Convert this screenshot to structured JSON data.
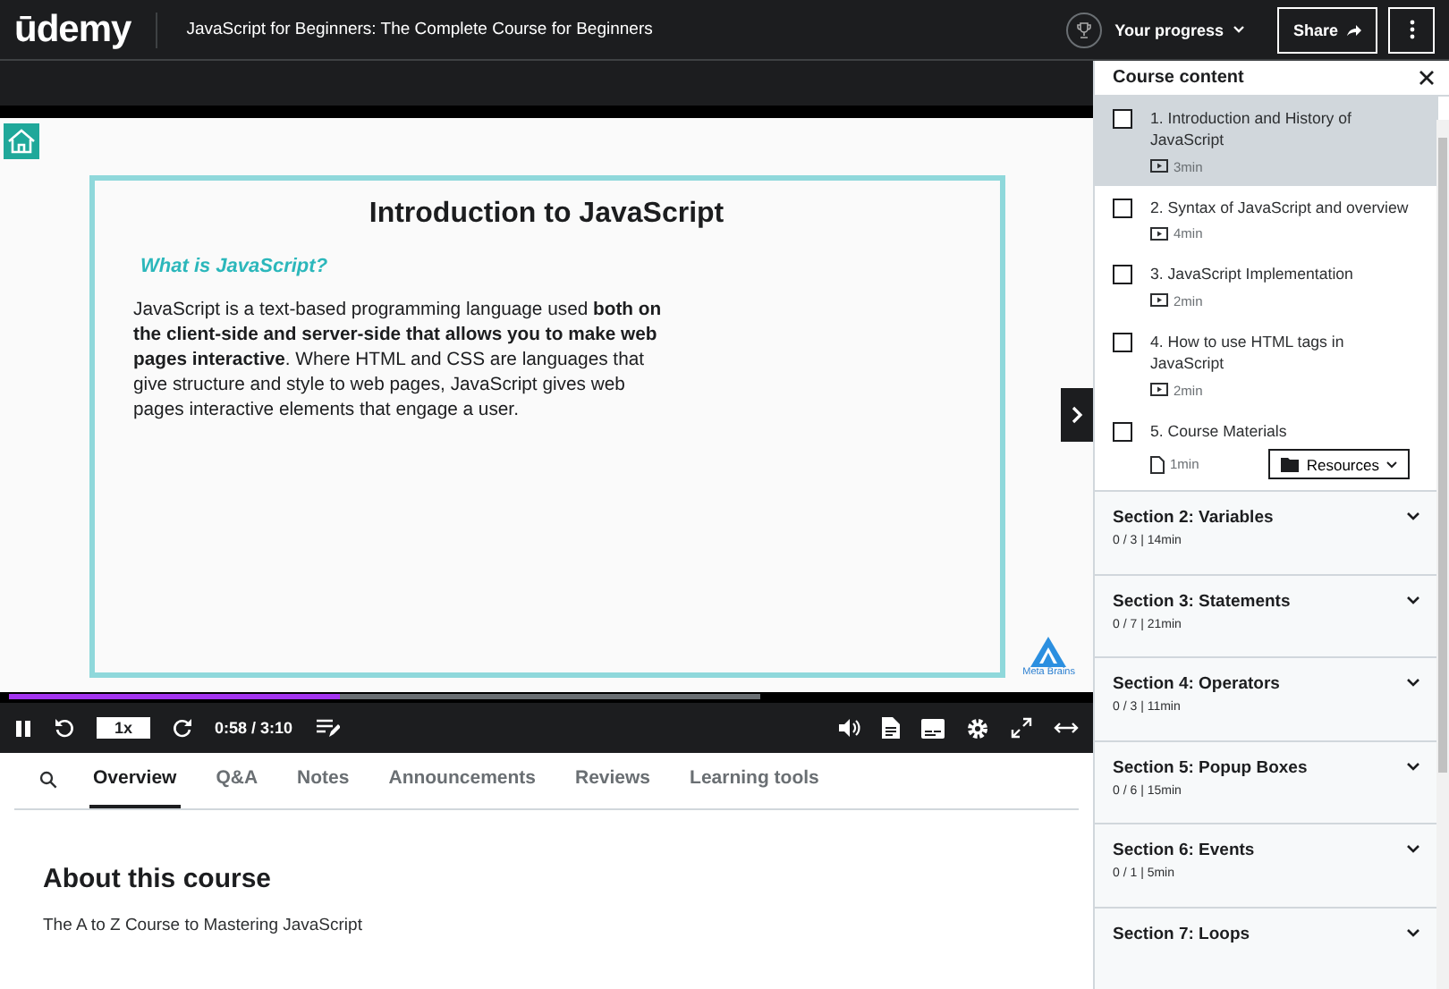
{
  "header": {
    "logo": "ūdemy",
    "course_title": "JavaScript for Beginners: The Complete Course for Beginners",
    "progress_label": "Your progress",
    "share_label": "Share"
  },
  "video": {
    "slide": {
      "title": "Introduction to JavaScript",
      "subtitle": "What is JavaScript?",
      "body": "JavaScript is a text-based programming language used **both on the client-side and server-side that allows you to make web pages interactive**. Where HTML and CSS are languages that give structure and style to web pages, JavaScript gives web pages interactive elements that engage a user.",
      "brand": "Meta Brains"
    },
    "progress": {
      "level": 0.305
    },
    "controls": {
      "playing": true,
      "speed": "1x",
      "time": "0:58 / 3:10"
    }
  },
  "tabs": [
    {
      "label": "Overview",
      "selected": true
    },
    {
      "label": "Q&A",
      "selected": false
    },
    {
      "label": "Notes",
      "selected": false
    },
    {
      "label": "Announcements",
      "selected": false
    },
    {
      "label": "Reviews",
      "selected": false
    },
    {
      "label": "Learning tools",
      "selected": false
    }
  ],
  "about": {
    "heading": "About this course",
    "text": "The A to Z Course to Mastering JavaScript"
  },
  "sidebar": {
    "title": "Course content",
    "lessons": [
      {
        "title": "1. Introduction and History of JavaScript",
        "duration": "3min",
        "kind": "video",
        "checked": false,
        "selected": true
      },
      {
        "title": "2. Syntax of JavaScript and overview",
        "duration": "4min",
        "kind": "video",
        "checked": false,
        "selected": false
      },
      {
        "title": "3. JavaScript Implementation",
        "duration": "2min",
        "kind": "video",
        "checked": false,
        "selected": false
      },
      {
        "title": "4. How to use HTML tags in JavaScript",
        "duration": "2min",
        "kind": "video",
        "checked": false,
        "selected": false
      },
      {
        "title": "5. Course Materials",
        "duration": "1min",
        "kind": "file",
        "checked": false,
        "selected": false,
        "resources": "Resources"
      }
    ],
    "sections": [
      {
        "title": "Section 2: Variables",
        "meta": "0 / 3 | 14min",
        "expanded": false
      },
      {
        "title": "Section 3: Statements",
        "meta": "0 / 7 | 21min",
        "expanded": false
      },
      {
        "title": "Section 4: Operators",
        "meta": "0 / 3 | 11min",
        "expanded": false
      },
      {
        "title": "Section 5: Popup Boxes",
        "meta": "0 / 6 | 15min",
        "expanded": false
      },
      {
        "title": "Section 6: Events",
        "meta": "0 / 1 | 5min",
        "expanded": false
      },
      {
        "title": "Section 7: Loops",
        "expanded": false
      }
    ]
  }
}
